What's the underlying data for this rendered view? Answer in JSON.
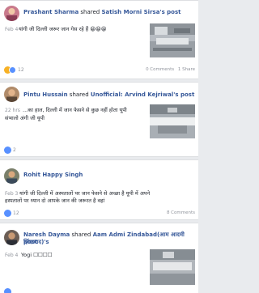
{
  "posts": [
    {
      "author": "Prashant Sharma",
      "verb": "shared",
      "source": "Satish Morni Sirsa's post",
      "time": "Feb 4",
      "text": "यांगी जी दिल्ली जरूर जान गेस रहे हैं 😀😀😀",
      "reaction_count": "12",
      "comments": "0 Comments",
      "shares": "1 Share"
    },
    {
      "author": "Pintu Hussain",
      "verb": "shared",
      "source": "Unofficial: Arvind Kejriwal's post",
      "time": "22 hrs",
      "text_line1": "...का हाल, दिल्ली में जान फेसने से कुछ नहीं होता यूपी",
      "text_line2": "संभालो अंगी जी यूपी",
      "reaction_count": "2"
    },
    {
      "author": "Rohit Happy Singh",
      "time": "Feb 3",
      "text_line1": "यांगी जी दिल्ली में अस्पतालों पर जान फेसने से अच्छा है यूपी में अपने",
      "text_line2": "हस्पतालों पर ध्यान दो आपके जान की जरूरत है वहां",
      "reaction_count": "12",
      "comments": "8 Comments"
    },
    {
      "author": "Naresh Dayma",
      "verb": "shared",
      "source": "Aam Admi Zindabad(आम आदमी ज़िंदाबाद)'s",
      "source_line2": "post",
      "time": "Feb 4",
      "text": "Yogi ☐☐☐☐"
    }
  ],
  "colors": {
    "link": "#365899",
    "like": "#5890ff",
    "haha": "#f7b125",
    "meta": "#90949c"
  }
}
